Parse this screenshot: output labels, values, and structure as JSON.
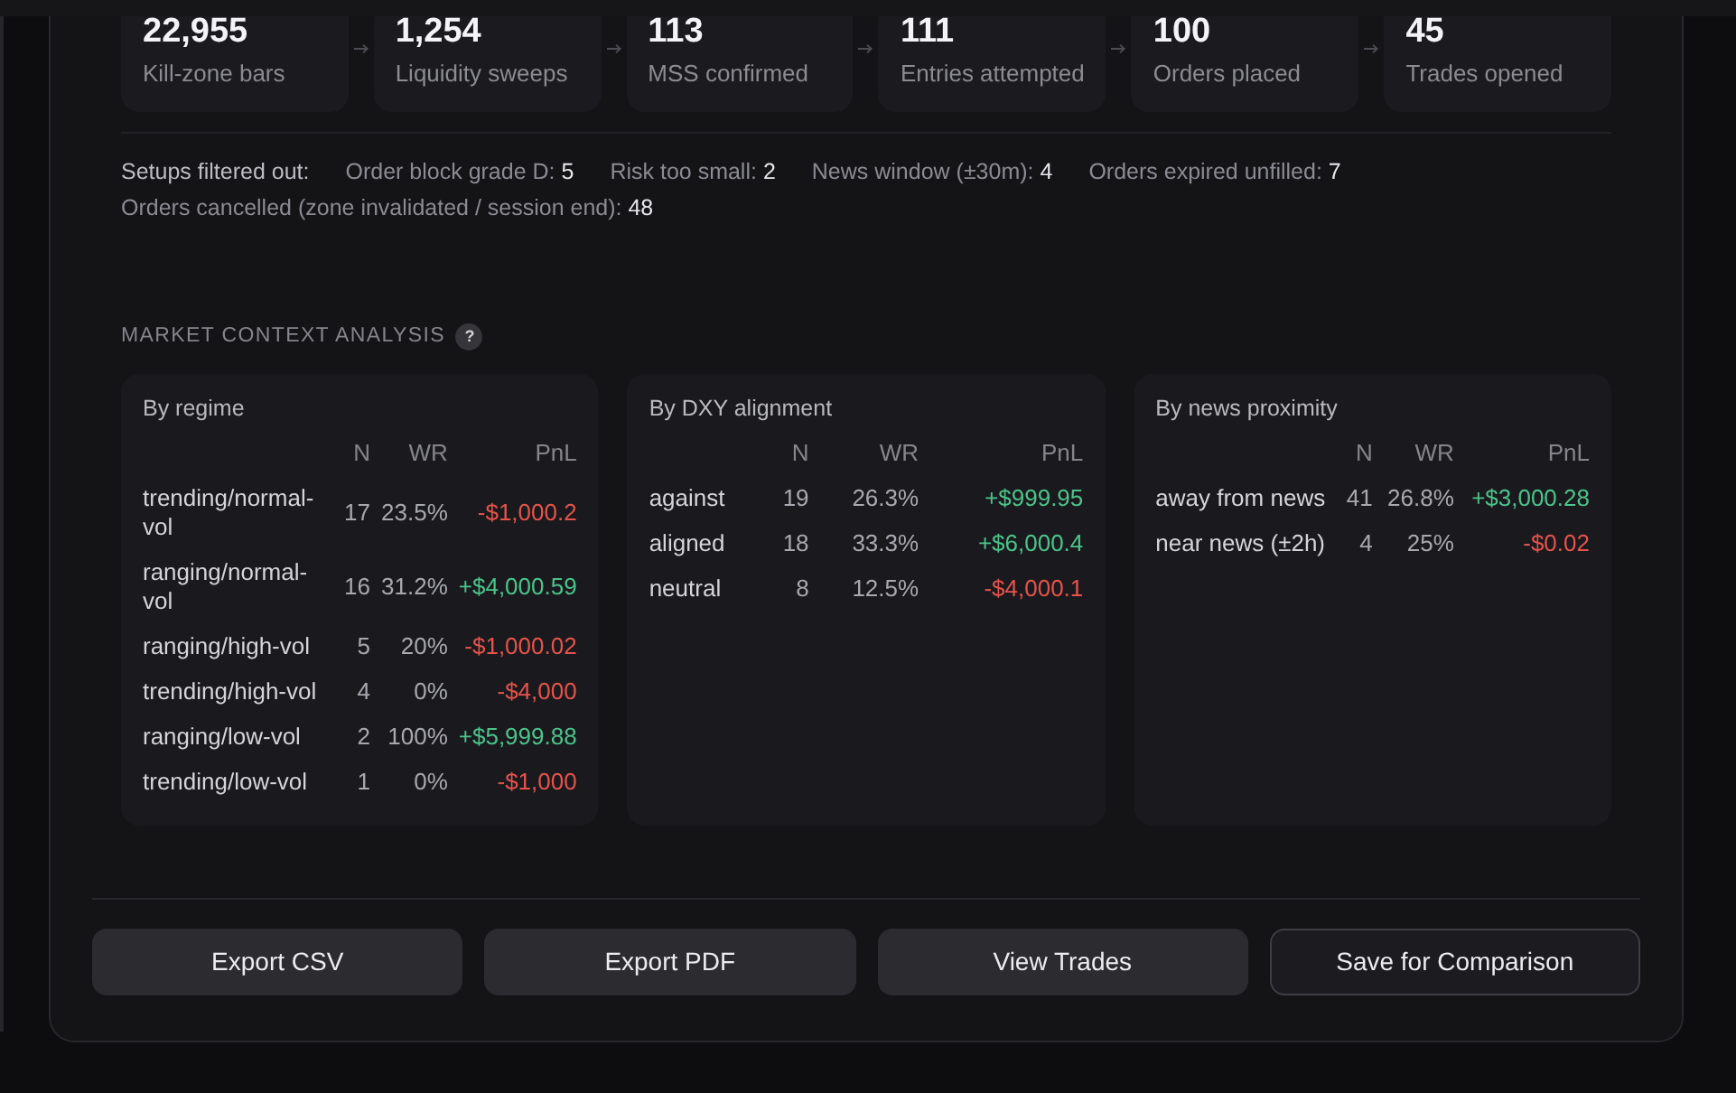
{
  "funnel": [
    {
      "value": "22,955",
      "label": "Kill-zone bars"
    },
    {
      "value": "1,254",
      "label": "Liquidity sweeps"
    },
    {
      "value": "113",
      "label": "MSS confirmed"
    },
    {
      "value": "111",
      "label": "Entries attempted"
    },
    {
      "value": "100",
      "label": "Orders placed"
    },
    {
      "value": "45",
      "label": "Trades opened"
    }
  ],
  "filters": {
    "title": "Setups filtered out:",
    "items": [
      {
        "label": "Order block grade D:",
        "value": "5"
      },
      {
        "label": "Risk too small:",
        "value": "2"
      },
      {
        "label": "News window (±30m):",
        "value": "4"
      },
      {
        "label": "Orders expired unfilled:",
        "value": "7"
      },
      {
        "label": "Orders cancelled (zone invalidated / session end):",
        "value": "48"
      }
    ]
  },
  "market_context": {
    "title": "MARKET CONTEXT ANALYSIS",
    "help": "?",
    "panels": [
      {
        "title": "By regime",
        "columns": [
          "N",
          "WR",
          "PnL"
        ],
        "rows": [
          {
            "label": "trending/normal-vol",
            "n": "17",
            "wr": "23.5%",
            "pnl": "-$1,000.2",
            "color": "#e5534b"
          },
          {
            "label": "ranging/normal-vol",
            "n": "16",
            "wr": "31.2%",
            "pnl": "+$4,000.59",
            "color": "#4cc38a"
          },
          {
            "label": "ranging/high-vol",
            "n": "5",
            "wr": "20%",
            "pnl": "-$1,000.02",
            "color": "#e5534b"
          },
          {
            "label": "trending/high-vol",
            "n": "4",
            "wr": "0%",
            "pnl": "-$4,000",
            "color": "#e5534b"
          },
          {
            "label": "ranging/low-vol",
            "n": "2",
            "wr": "100%",
            "pnl": "+$5,999.88",
            "color": "#4cc38a"
          },
          {
            "label": "trending/low-vol",
            "n": "1",
            "wr": "0%",
            "pnl": "-$1,000",
            "color": "#e5534b"
          }
        ]
      },
      {
        "title": "By DXY alignment",
        "columns": [
          "N",
          "WR",
          "PnL"
        ],
        "rows": [
          {
            "label": "against",
            "n": "19",
            "wr": "26.3%",
            "pnl": "+$999.95",
            "color": "#4cc38a"
          },
          {
            "label": "aligned",
            "n": "18",
            "wr": "33.3%",
            "pnl": "+$6,000.4",
            "color": "#4cc38a"
          },
          {
            "label": "neutral",
            "n": "8",
            "wr": "12.5%",
            "pnl": "-$4,000.1",
            "color": "#e5534b"
          }
        ]
      },
      {
        "title": "By news proximity",
        "columns": [
          "N",
          "WR",
          "PnL"
        ],
        "rows": [
          {
            "label": "away from news",
            "n": "41",
            "wr": "26.8%",
            "pnl": "+$3,000.28",
            "color": "#4cc38a"
          },
          {
            "label": "near news (±2h)",
            "n": "4",
            "wr": "25%",
            "pnl": "-$0.02",
            "color": "#e5534b"
          }
        ]
      }
    ]
  },
  "actions": [
    {
      "label": "Export CSV",
      "kind": "filled"
    },
    {
      "label": "Export PDF",
      "kind": "filled"
    },
    {
      "label": "View Trades",
      "kind": "filled"
    },
    {
      "label": "Save for Comparison",
      "kind": "outline"
    }
  ]
}
